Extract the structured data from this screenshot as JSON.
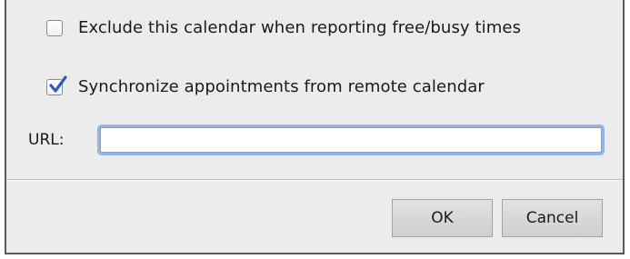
{
  "dialog": {
    "exclude_checkbox": {
      "label": "Exclude this calendar when reporting free/busy times",
      "checked": false
    },
    "sync_checkbox": {
      "label": "Synchronize appointments from remote calendar",
      "checked": true
    },
    "url": {
      "label": "URL:",
      "value": ""
    },
    "buttons": {
      "ok_label": "OK",
      "cancel_label": "Cancel"
    }
  },
  "colors": {
    "accent": "#2f5fb5",
    "focus_ring": "#8fb8e8",
    "background": "#ececec"
  }
}
